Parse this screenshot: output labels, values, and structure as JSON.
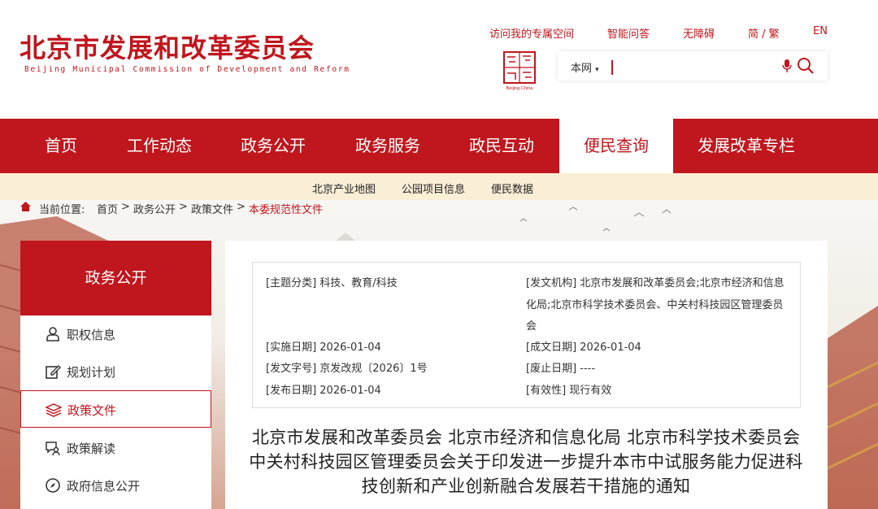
{
  "header": {
    "title": "北京市发展和改革委员会",
    "subtitle": "Beijing Municipal Commission of Development and Reform",
    "seal_text": "Beijing·China",
    "top_links": [
      "访问我的专属空间",
      "智能问答",
      "无障碍",
      "简 / 繁",
      "EN"
    ],
    "search": {
      "scope": "本网",
      "placeholder": "",
      "value": ""
    }
  },
  "nav": {
    "items": [
      "首页",
      "工作动态",
      "政务公开",
      "政务服务",
      "政民互动",
      "便民查询",
      "发展改革专栏"
    ],
    "active_index": 5
  },
  "subnav": [
    "北京产业地图",
    "公园项目信息",
    "便民数据"
  ],
  "breadcrumb": {
    "prefix": "当前位置:",
    "items": [
      "首页",
      "政务公开",
      "政策文件"
    ],
    "current": "本委规范性文件",
    "separator": ">"
  },
  "sidebar": {
    "title": "政务公开",
    "items": [
      {
        "label": "职权信息",
        "icon": "person-icon"
      },
      {
        "label": "规划计划",
        "icon": "edit-icon"
      },
      {
        "label": "政策文件",
        "icon": "layers-icon",
        "active": true
      },
      {
        "label": "政策解读",
        "icon": "chat-user-icon"
      },
      {
        "label": "政府信息公开",
        "icon": "compass-icon"
      }
    ]
  },
  "meta": {
    "subject": "[主题分类] 科技、教育/科技",
    "issuer": "[发文机构] 北京市发展和改革委员会;北京市经济和信息化局;北京市科学技术委员会、中关村科技园区管理委员会",
    "effective_date": "[实施日期] 2026-01-04",
    "written_date": "[成文日期] 2026-01-04",
    "doc_number": "[发文字号] 京发改规〔2026〕1号",
    "repeal_date": "[废止日期] ----",
    "publish_date": "[发布日期] 2026-01-04",
    "validity": "[有效性] 现行有效"
  },
  "document": {
    "title": "北京市发展和改革委员会 北京市经济和信息化局 北京市科学技术委员会 中关村科技园区管理委员会关于印发进一步提升本市中试服务能力促进科技创新和产业创新融合发展若干措施的通知"
  },
  "colors": {
    "brand": "#c0161d",
    "subnav_bg": "#fbeed7"
  }
}
